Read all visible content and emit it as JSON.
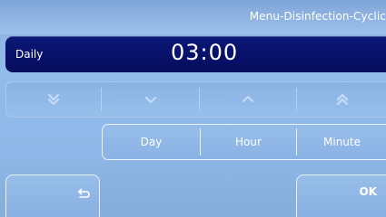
{
  "header": {
    "title": "Menu-Disinfection-Cyclic"
  },
  "parameter": {
    "label": "Daily",
    "value": "03:00"
  },
  "adjust": {
    "icons": [
      "double-chevron-down-icon",
      "chevron-down-icon",
      "chevron-up-icon",
      "double-chevron-up-icon"
    ]
  },
  "units": {
    "day_label": "Day",
    "hour_label": "Hour",
    "minute_label": "Minute"
  },
  "footer": {
    "back_icon": "return-arrow-icon",
    "ok_label": "OK"
  },
  "colors": {
    "background": "#8eb6e6",
    "value_bar": "#08116a",
    "text": "#ffffff",
    "arrow_glyph": "#c7dcf6"
  }
}
